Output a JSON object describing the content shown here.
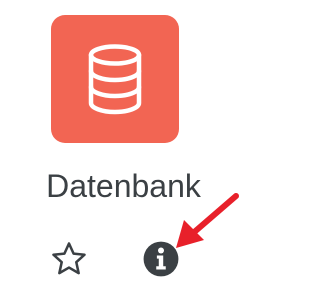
{
  "tile": {
    "name": "Datenbank",
    "icon": "database-icon",
    "color": "#f26553"
  },
  "actions": {
    "star_icon": "star-outline-icon",
    "info_icon": "info-icon"
  },
  "annotation": {
    "arrow_icon": "red-arrow-icon",
    "color": "#e8202a"
  }
}
